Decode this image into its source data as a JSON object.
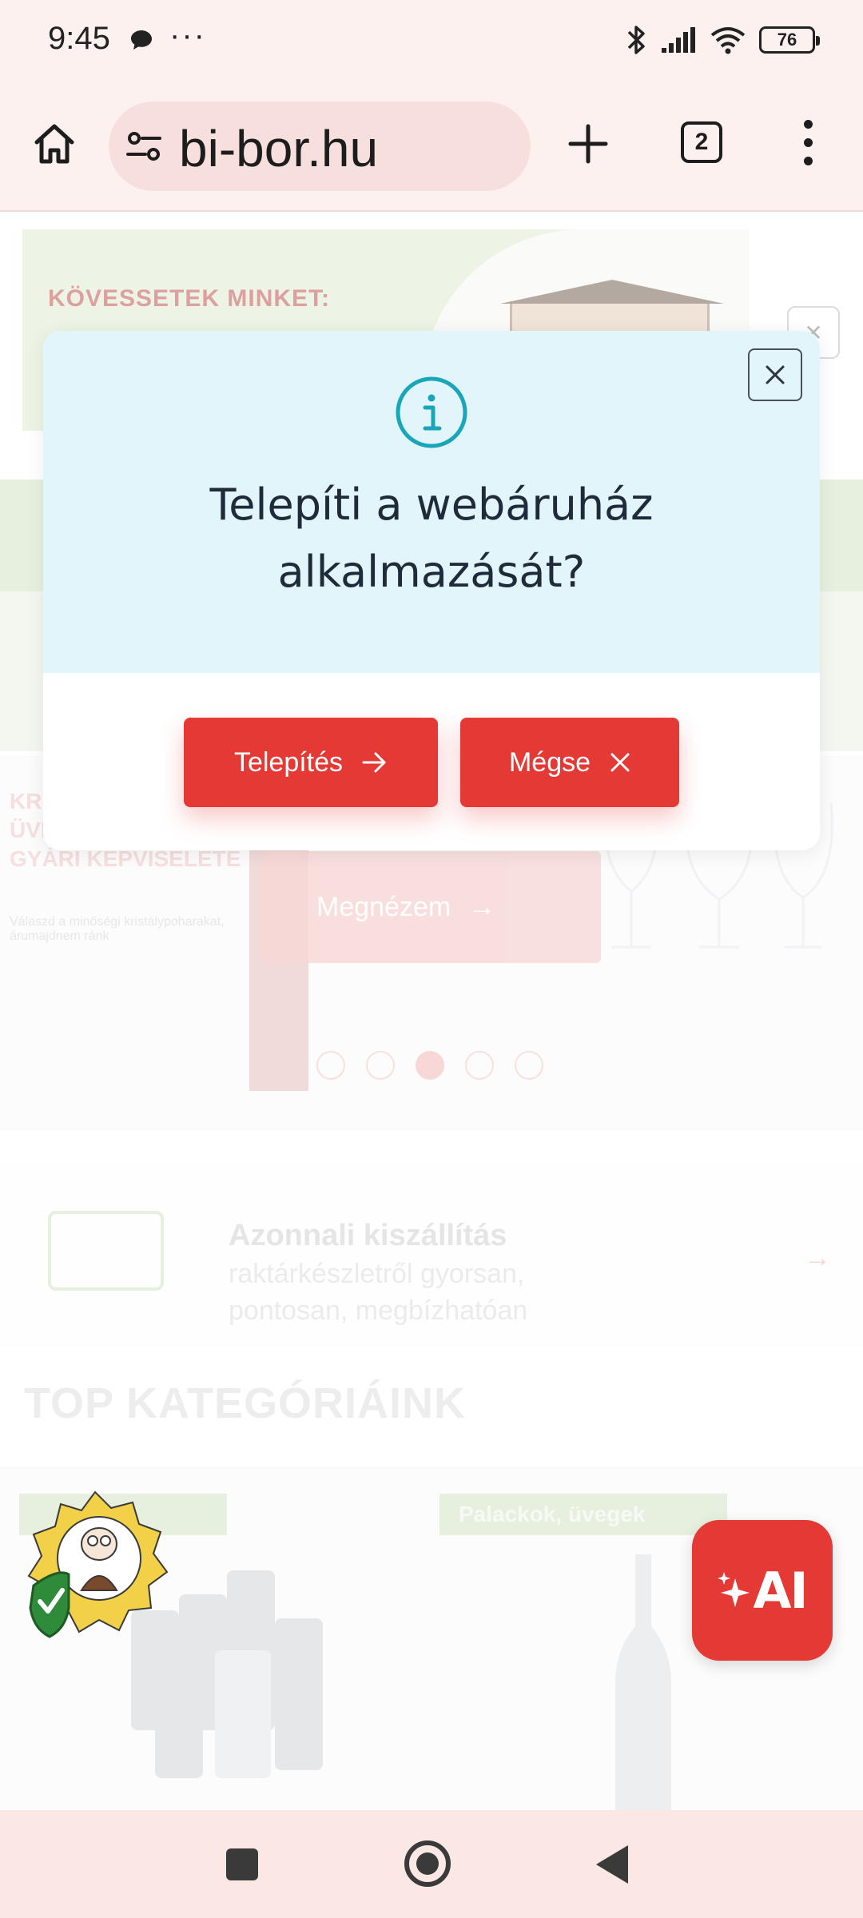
{
  "status_bar": {
    "time": "9:45",
    "more": "···",
    "battery": "76"
  },
  "browser": {
    "url": "bi-bor.hu",
    "tab_count": "2"
  },
  "background_page": {
    "banner_text": "KÖVESSETEK MINKET:",
    "banner_close": "✕",
    "hero_text": "KRISTÁLY- ÉS ÜVEGPOHÁRAK GYÁRI KÉPVISELETE",
    "hero_small": "Válaszd a minőségi kristálypoharakat, árumajdnem ránk",
    "hero_button": "Megnézem",
    "hero_slide_count": 5,
    "hero_active_slide": 3,
    "delivery_title": "Azonnali kiszállítás",
    "delivery_subtitle": "raktárkészletről gyorsan, pontosan, megbízhatóan",
    "top_categories_heading": "TOP KATEGÓRIÁINK",
    "category_right_label": "Palackok, üvegek"
  },
  "modal": {
    "title": "Telepíti a webáruház alkalmazását?",
    "install_label": "Telepítés",
    "cancel_label": "Mégse",
    "close_icon": "close-icon",
    "info_icon": "info-icon"
  },
  "ai_fab": {
    "label": "AI"
  },
  "colors": {
    "accent": "#e53935",
    "modal_header": "#e1f5fa",
    "info_teal": "#1aa6b9"
  }
}
